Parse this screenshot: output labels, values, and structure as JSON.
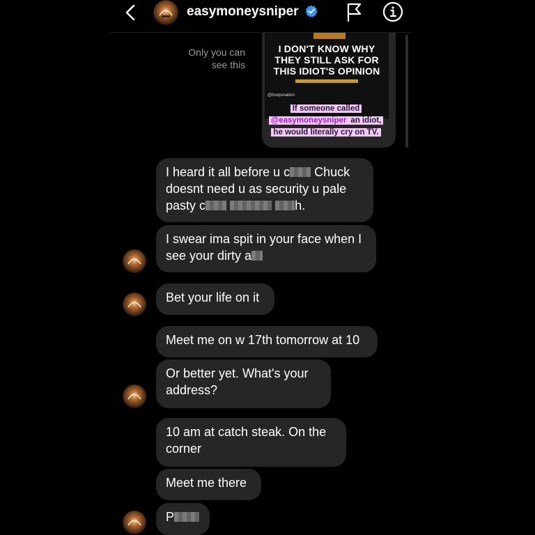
{
  "header": {
    "username": "easymoneysniper"
  },
  "shared_story": {
    "notice": "Only you can\nsee this",
    "headline": "I DON'T KNOW WHY\nTHEY STILL ASK FOR\nTHIS IDIOT'S OPINION",
    "source_handle": "@hoopsnation",
    "caption_before": "If someone called",
    "caption_mention": "@easymoneysniper",
    "caption_after": "an idiot, he would literally cry on TV."
  },
  "messages": [
    {
      "parts": [
        "I heard it all before u c",
        "Chuck doesnt need u as security u pale pasty c",
        "h."
      ]
    },
    {
      "parts": [
        "I swear ima spit in your face when I see your dirty a"
      ]
    },
    {
      "text": "Bet your life on it"
    },
    {
      "text": "Meet me on w 17th tomorrow at 10"
    },
    {
      "text": "Or better yet. What's your address?"
    },
    {
      "text": "10 am at catch steak. On the corner"
    },
    {
      "text": "Meet me there"
    },
    {
      "parts": [
        "P"
      ]
    }
  ],
  "colors": {
    "background": "#000000",
    "bubble": "#262626",
    "verified": "#3897f0",
    "caption_highlight": "#f4c8f5"
  }
}
